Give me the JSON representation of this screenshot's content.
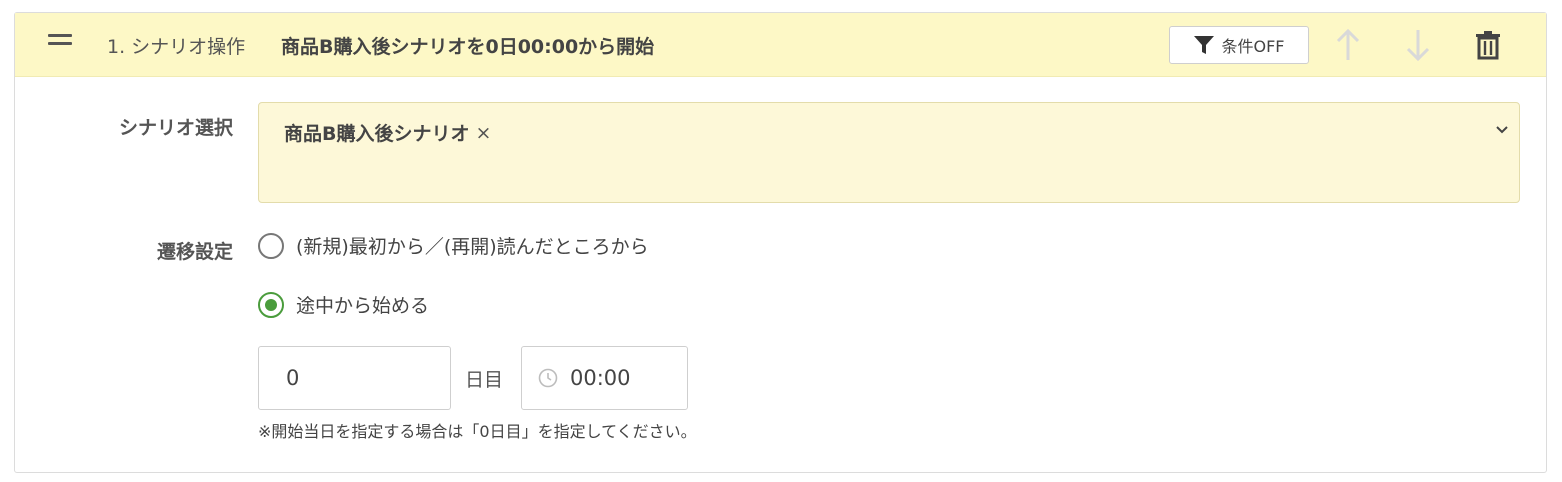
{
  "header": {
    "step_label": "1. シナリオ操作",
    "summary": "商品B購入後シナリオを0日00:00から開始",
    "filter_label": "条件OFF"
  },
  "scenario": {
    "label": "シナリオ選択",
    "selected_tag": "商品B購入後シナリオ",
    "remove_symbol": "×"
  },
  "transition": {
    "label": "遷移設定",
    "options": [
      {
        "label": "(新規)最初から／(再開)読んだところから",
        "selected": false
      },
      {
        "label": "途中から始める",
        "selected": true
      }
    ],
    "day_value": "0",
    "day_unit": "日目",
    "time_value": "00:00",
    "note": "※開始当日を指定する場合は「0日目」を指定してください。"
  },
  "colors": {
    "header_bg": "#fdf8c6",
    "select_bg": "#fdf8d8",
    "radio_checked": "#4a9c3c",
    "disabled_arrow": "#d9d9d9"
  },
  "icons": [
    "drag-handle-icon",
    "filter-icon",
    "arrow-up-icon",
    "arrow-down-icon",
    "trash-icon",
    "chevron-down-icon",
    "clock-icon"
  ]
}
